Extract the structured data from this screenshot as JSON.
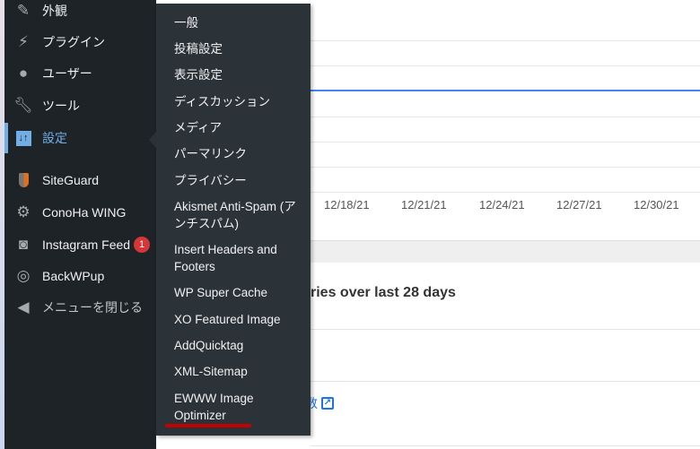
{
  "sidebar": {
    "items": [
      {
        "label": "外観",
        "icon": "paintbrush-icon"
      },
      {
        "label": "プラグイン",
        "icon": "plugin-icon"
      },
      {
        "label": "ユーザー",
        "icon": "user-icon"
      },
      {
        "label": "ツール",
        "icon": "wrench-icon"
      },
      {
        "label": "設定",
        "icon": "settings-icon",
        "active": true
      },
      {
        "label": "SiteGuard",
        "icon": "shield-icon"
      },
      {
        "label": "ConoHa WING",
        "icon": "gear-icon"
      },
      {
        "label": "Instagram Feed",
        "icon": "camera-icon",
        "badge": "1"
      },
      {
        "label": "BackWPup",
        "icon": "backup-icon"
      },
      {
        "label": "メニューを閉じる",
        "icon": "collapse-icon"
      }
    ]
  },
  "flyout": {
    "items": [
      "一般",
      "投稿設定",
      "表示設定",
      "ディスカッション",
      "メディア",
      "パーマリンク",
      "プライバシー",
      "Akismet Anti-Spam (アンチスパム)",
      "Insert Headers and Footers",
      "WP Super Cache",
      "XO Featured Image",
      "AddQuicktag",
      "XML-Sitemap",
      "EWWW Image Optimizer"
    ]
  },
  "chart": {
    "x_ticks": [
      "12/18/21",
      "12/21/21",
      "12/24/21",
      "12/27/21",
      "12/30/21"
    ],
    "line_color": "#4285f4"
  },
  "card": {
    "title": "ries over last 28 days",
    "link": "数"
  },
  "colors": {
    "sidebar": "#1d2327",
    "flyout": "#2c3338",
    "accent": "#72aee6",
    "badge": "#d63638",
    "highlight": "#c40000"
  }
}
